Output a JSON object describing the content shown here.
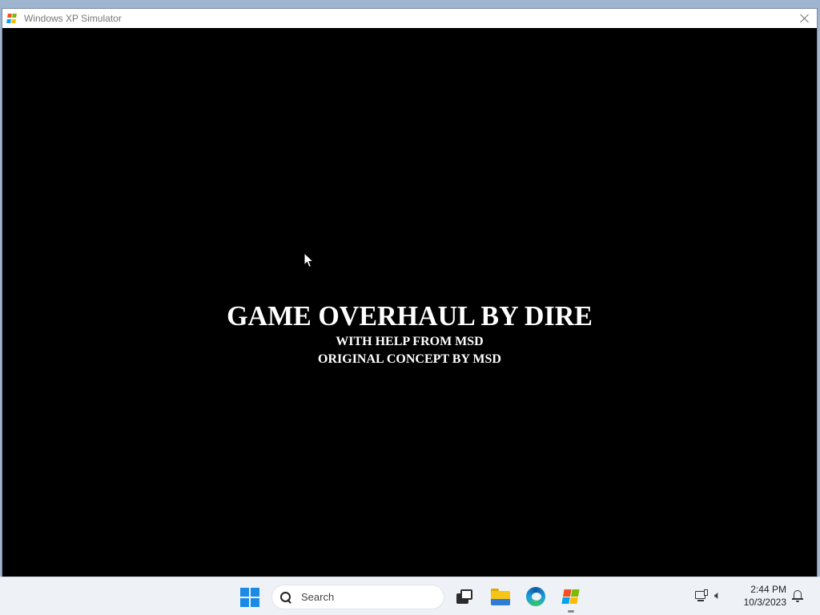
{
  "window": {
    "title": "Windows XP Simulator",
    "close_icon": "close-icon"
  },
  "game": {
    "credits": {
      "main": "GAME OVERHAUL BY DIRE",
      "line1": "WITH HELP FROM MSD",
      "line2": "ORIGINAL CONCEPT BY MSD"
    },
    "background_color": "#000000",
    "text_color": "#ffffff"
  },
  "taskbar": {
    "start_icon": "windows-start-icon",
    "search": {
      "label": "Search",
      "icon": "search-icon"
    },
    "pinned_apps": [
      {
        "name": "task-view",
        "icon": "task-view-icon"
      },
      {
        "name": "file-explorer",
        "icon": "folder-icon"
      },
      {
        "name": "microsoft-edge",
        "icon": "edge-icon"
      },
      {
        "name": "windows-xp-simulator",
        "icon": "xp-flag-icon",
        "running": true
      }
    ],
    "tray": {
      "network_icon": "network-icon",
      "volume_icon": "volume-icon",
      "time": "2:44 PM",
      "date": "10/3/2023",
      "notification_icon": "bell-icon"
    },
    "accent": "#1a8ae6"
  }
}
